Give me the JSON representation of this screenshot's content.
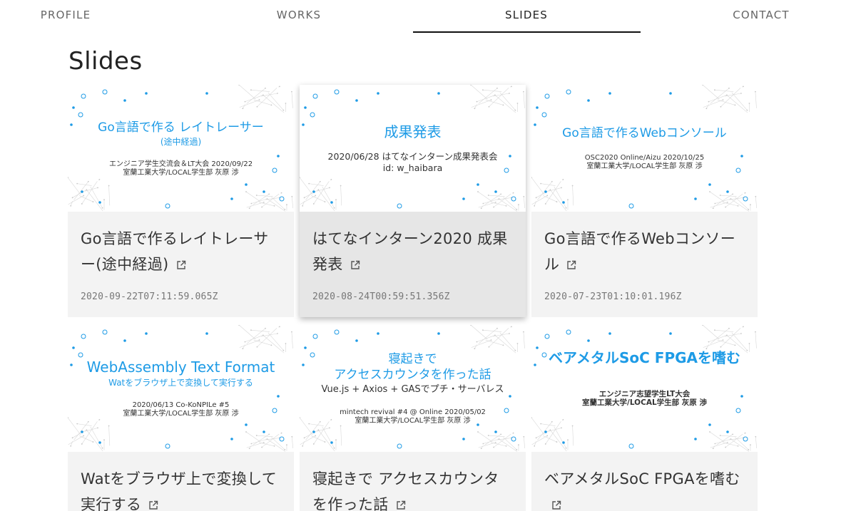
{
  "nav": {
    "tabs": [
      {
        "label": "PROFILE"
      },
      {
        "label": "WORKS"
      },
      {
        "label": "SLIDES"
      },
      {
        "label": "CONTACT"
      }
    ],
    "active": "SLIDES"
  },
  "page": {
    "title": "Slides"
  },
  "colors": {
    "accent": "#1e9be6",
    "card_bg": "#f3f3f3",
    "card_active_bg": "#e6e6e6"
  },
  "icons": {
    "external_link": "external-link-icon"
  },
  "slides": [
    {
      "thumb": {
        "main": "Go言語で作る レイトレーサー",
        "sub": "(途中経過)",
        "meta1": "エンジニア学生交流会＆LT大会 2020/09/22",
        "meta2": "室蘭工業大学/LOCAL学生部 灰原 渉"
      },
      "title": "Go言語で作るレイトレーサー(途中経過)",
      "date": "2020-09-22T07:11:59.065Z"
    },
    {
      "thumb": {
        "main": "成果発表",
        "meta1": "2020/06/28 はてなインターン成果発表会",
        "meta2": "id: w_haibara"
      },
      "title": "はてなインターン2020 成果発表",
      "date": "2020-08-24T00:59:51.356Z"
    },
    {
      "thumb": {
        "main": "Go言語で作るWebコンソール",
        "meta1": "OSC2020 Online/Aizu 2020/10/25",
        "meta2": "室蘭工業大学/LOCAL学生部 灰原 渉"
      },
      "title": "Go言語で作るWebコンソール",
      "date": "2020-07-23T01:10:01.196Z"
    },
    {
      "thumb": {
        "main": "WebAssembly Text Format",
        "sub": "Watをブラウザ上で変換して実行する",
        "meta1": "2020/06/13 Co-KoNPILe #5",
        "meta2": "室蘭工業大学/LOCAL学生部 灰原 渉"
      },
      "title": "Watをブラウザ上で変換して実行する"
    },
    {
      "thumb": {
        "main1": "寝起きで",
        "main2": "アクセスカウンタを作った話",
        "sub2": "Vue.js + Axios + GASでプチ・サーバレス",
        "meta1": "mintech revival #4 @ Online 2020/05/02",
        "meta2": "室蘭工業大学/LOCAL学生部 灰原 渉"
      },
      "title": "寝起きで アクセスカウンタを作った話"
    },
    {
      "thumb": {
        "main": "ベアメタルSoC FPGAを嗜む",
        "meta1": "エンジニア志望学生LT大会",
        "meta2": "室蘭工業大学/LOCAL学生部 灰原 渉"
      },
      "title": "ベアメタルSoC FPGAを嗜む"
    }
  ]
}
